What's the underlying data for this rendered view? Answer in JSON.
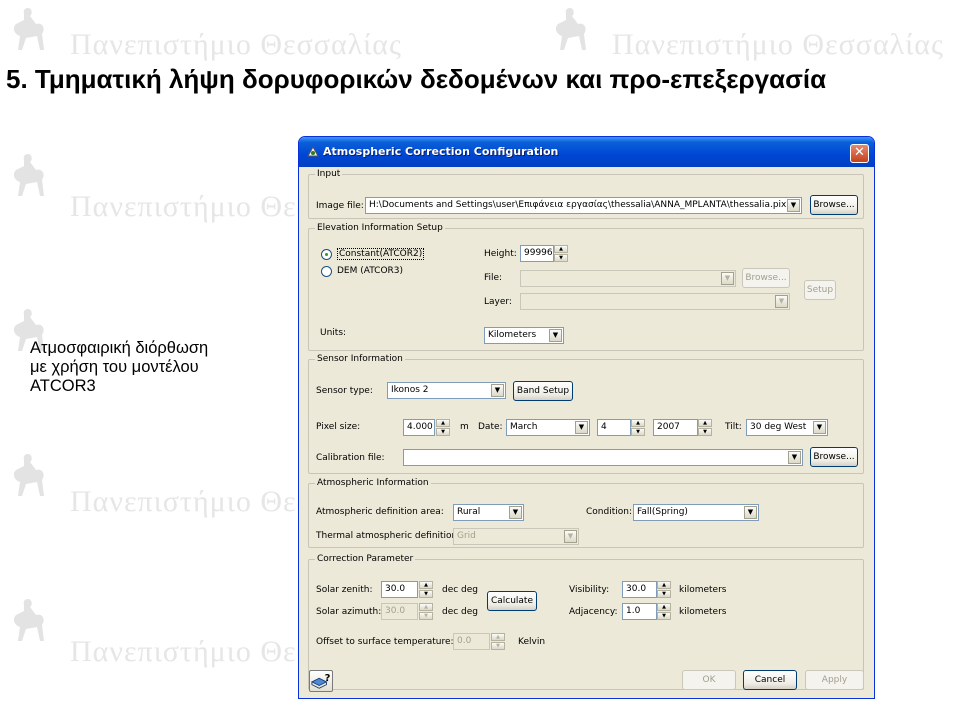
{
  "slide": {
    "watermark_text": "Πανεπιστήμιο Θεσσαλίας",
    "title": "5. Τμηματική λήψη δορυφορικών δεδομένων και προ-επεξεργασία",
    "caption_lines": [
      "Ατμοσφαιρική διόρθωση",
      "με χρήση του μοντέλου",
      "ATCOR3"
    ]
  },
  "dialog": {
    "title": "Atmospheric Correction Configuration",
    "close_glyph": "✕",
    "input": {
      "legend": "Input",
      "image_file_label": "Image file:",
      "image_file_value": "H:\\Documents and Settings\\user\\Επιφάνεια εργασίας\\thessalia\\ANNA_MPLANTA\\thessalia.pix",
      "browse_label": "Browse..."
    },
    "elevation": {
      "legend": "Elevation Information Setup",
      "constant_label": "Constant(ATCOR2)",
      "dem_label": "DEM (ATCOR3)",
      "height_label": "Height:",
      "height_value": "99996",
      "file_label": "File:",
      "file_value": "",
      "browse_label": "Browse...",
      "layer_label": "Layer:",
      "layer_value": "",
      "setup_label": "Setup",
      "units_label": "Units:",
      "units_value": "Kilometers"
    },
    "sensor": {
      "legend": "Sensor Information",
      "type_label": "Sensor type:",
      "type_value": "Ikonos 2",
      "band_setup_label": "Band Setup",
      "pixel_label": "Pixel size:",
      "pixel_value": "4.000",
      "pixel_unit": "m",
      "date_label": "Date:",
      "month_value": "March",
      "day_value": "4",
      "year_value": "2007",
      "tilt_label": "Tilt:",
      "tilt_value": "30 deg West",
      "calib_label": "Calibration file:",
      "calib_value": "",
      "browse_label": "Browse..."
    },
    "atmos": {
      "legend": "Atmospheric Information",
      "area_label": "Atmospheric definition area:",
      "area_value": "Rural",
      "condition_label": "Condition:",
      "condition_value": "Fall(Spring)",
      "thermal_label": "Thermal atmospheric definition:",
      "thermal_value": "Grid"
    },
    "correction": {
      "legend": "Correction Parameter",
      "zenith_label": "Solar zenith:",
      "zenith_value": "30.0",
      "zenith_unit": "dec deg",
      "azimuth_label": "Solar azimuth:",
      "azimuth_value": "30.0",
      "azimuth_unit": "dec deg",
      "calculate_label": "Calculate",
      "visibility_label": "Visibility:",
      "visibility_value": "30.0",
      "visibility_unit": "kilometers",
      "adjacency_label": "Adjacency:",
      "adjacency_value": "1.0",
      "adjacency_unit": "kilometers",
      "offset_label": "Offset to surface temperature:",
      "offset_value": "0.0",
      "offset_unit": "Kelvin"
    },
    "buttons": {
      "ok": "OK",
      "cancel": "Cancel",
      "apply": "Apply",
      "help_glyph": "?"
    }
  },
  "icons": {
    "help": "help-book-icon",
    "title_icon": "app-icon",
    "dropdown": "chevron-down-icon"
  },
  "colors": {
    "titlebar": "#0046d5",
    "dialog_bg": "#ece9d8",
    "watermark": "#e6e6e6"
  }
}
